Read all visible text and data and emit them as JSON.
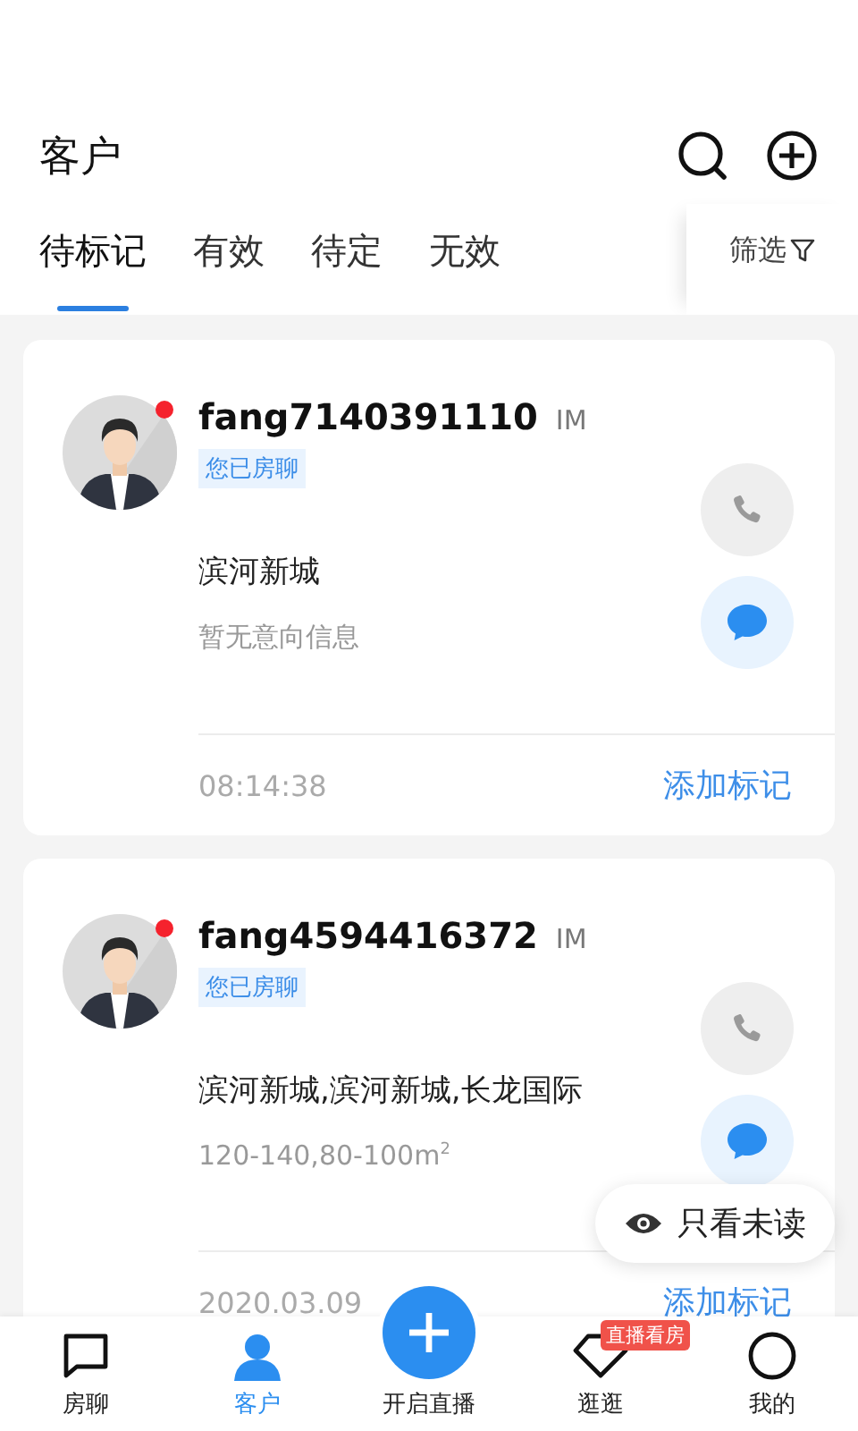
{
  "header": {
    "title": "客户"
  },
  "tabs": [
    {
      "label": "待标记",
      "selected": true
    },
    {
      "label": "有效",
      "selected": false
    },
    {
      "label": "待定",
      "selected": false
    },
    {
      "label": "无效",
      "selected": false
    }
  ],
  "filter": {
    "label": "筛选"
  },
  "customers": [
    {
      "name": "fang7140391110",
      "channel": "IM",
      "unread": true,
      "tag": "您已房聊",
      "project": "滨河新城",
      "intent": "暂无意向信息",
      "time": "08:14:38",
      "action": "添加标记"
    },
    {
      "name": "fang4594416372",
      "channel": "IM",
      "unread": true,
      "tag": "您已房聊",
      "project": "滨河新城,滨河新城,长龙国际",
      "intent": "120-140,80-100m$^{2}$",
      "time": "2020.03.09",
      "action": "添加标记"
    }
  ],
  "unread_only_toggle": {
    "label": "只看未读"
  },
  "bottom_nav": [
    {
      "kind": "chat",
      "label": "房聊",
      "selected": false
    },
    {
      "kind": "person",
      "label": "客户",
      "selected": true
    },
    {
      "kind": "fab",
      "label": "开启直播",
      "selected": false
    },
    {
      "kind": "diamond",
      "label": "逛逛",
      "selected": false,
      "badge": "直播看房"
    },
    {
      "kind": "circle",
      "label": "我的",
      "selected": false
    }
  ]
}
